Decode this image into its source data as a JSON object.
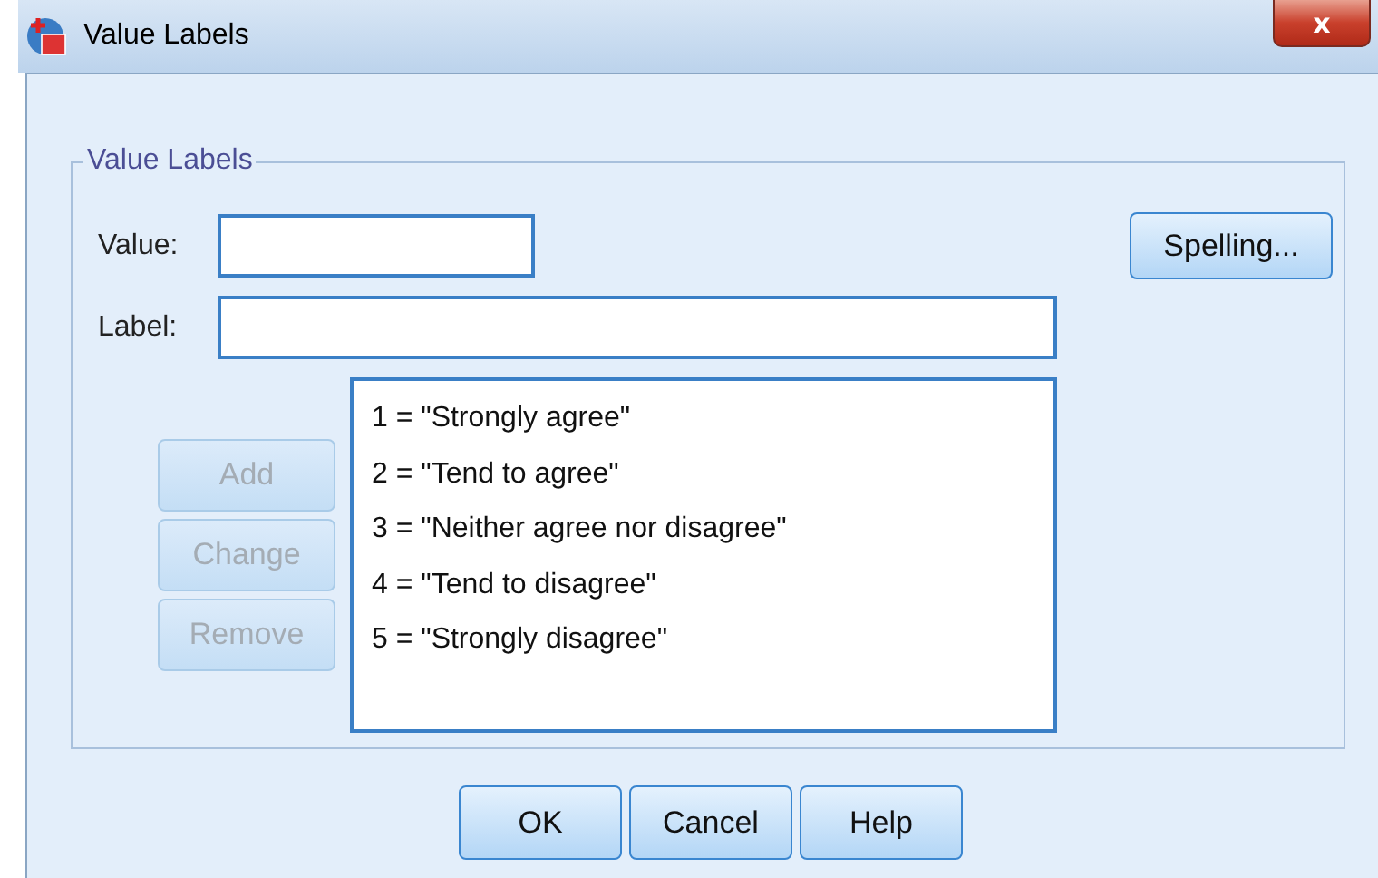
{
  "window": {
    "title": "Value Labels",
    "close": "x"
  },
  "group": {
    "title": "Value Labels"
  },
  "value_field": {
    "label": "Value:"
  },
  "label_field": {
    "label": "Label:"
  },
  "spelling_button": {
    "label": "Spelling...",
    "disabled": false
  },
  "side_buttons": [
    {
      "label": "Add",
      "disabled": true
    },
    {
      "label": "Change",
      "disabled": true
    },
    {
      "label": "Remove",
      "disabled": true
    }
  ],
  "labels_list": [
    "1 = \"Strongly agree\"",
    "2 = \"Tend to agree\"",
    "3 = \"Neither agree nor disagree\"",
    "4 = \"Tend to disagree\"",
    "5 = \"Strongly disagree\""
  ],
  "buttons": [
    {
      "label": "OK",
      "disabled": false
    },
    {
      "label": "Cancel",
      "disabled": false
    },
    {
      "label": "Help",
      "disabled": false
    }
  ]
}
